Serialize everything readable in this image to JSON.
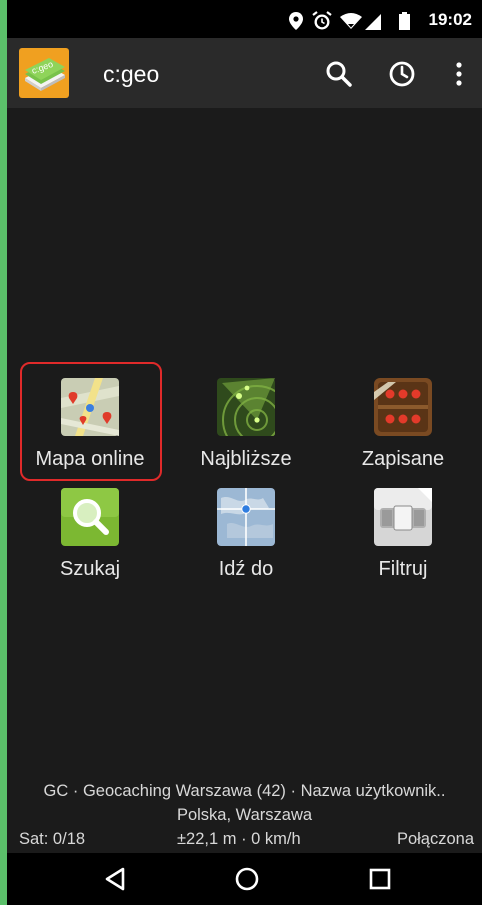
{
  "status_bar": {
    "time": "19:02",
    "icons": [
      "location-icon",
      "alarm-icon",
      "wifi-icon",
      "signal-icon",
      "battery-icon"
    ]
  },
  "app_bar": {
    "logo_text": "c:geo",
    "title": "c:geo",
    "actions": [
      "search-icon",
      "history-icon",
      "overflow-menu-icon"
    ]
  },
  "grid": {
    "tiles": [
      {
        "label": "Mapa online",
        "icon": "map-icon"
      },
      {
        "label": "Najbliższe",
        "icon": "radar-icon"
      },
      {
        "label": "Zapisane",
        "icon": "saved-caches-icon"
      },
      {
        "label": "Szukaj",
        "icon": "magnifier-icon"
      },
      {
        "label": "Idź do",
        "icon": "globe-icon"
      },
      {
        "label": "Filtruj",
        "icon": "filter-icon"
      }
    ]
  },
  "footer": {
    "account_line": "GC · Geocaching Warszawa (42) · Nazwa użytkownik..",
    "location_line": "Polska, Warszawa",
    "satellites": "Sat: 0/18",
    "accuracy_speed": "±22,1 m · 0 km/h",
    "connection": "Połączona"
  },
  "nav_bar": {
    "buttons": [
      "back-icon",
      "home-icon",
      "recents-icon"
    ]
  },
  "colors": {
    "accent_green": "#5bc06a",
    "highlight_red": "#e02a2a",
    "background": "#1b1b1b",
    "app_bar": "#2a2a2a"
  }
}
